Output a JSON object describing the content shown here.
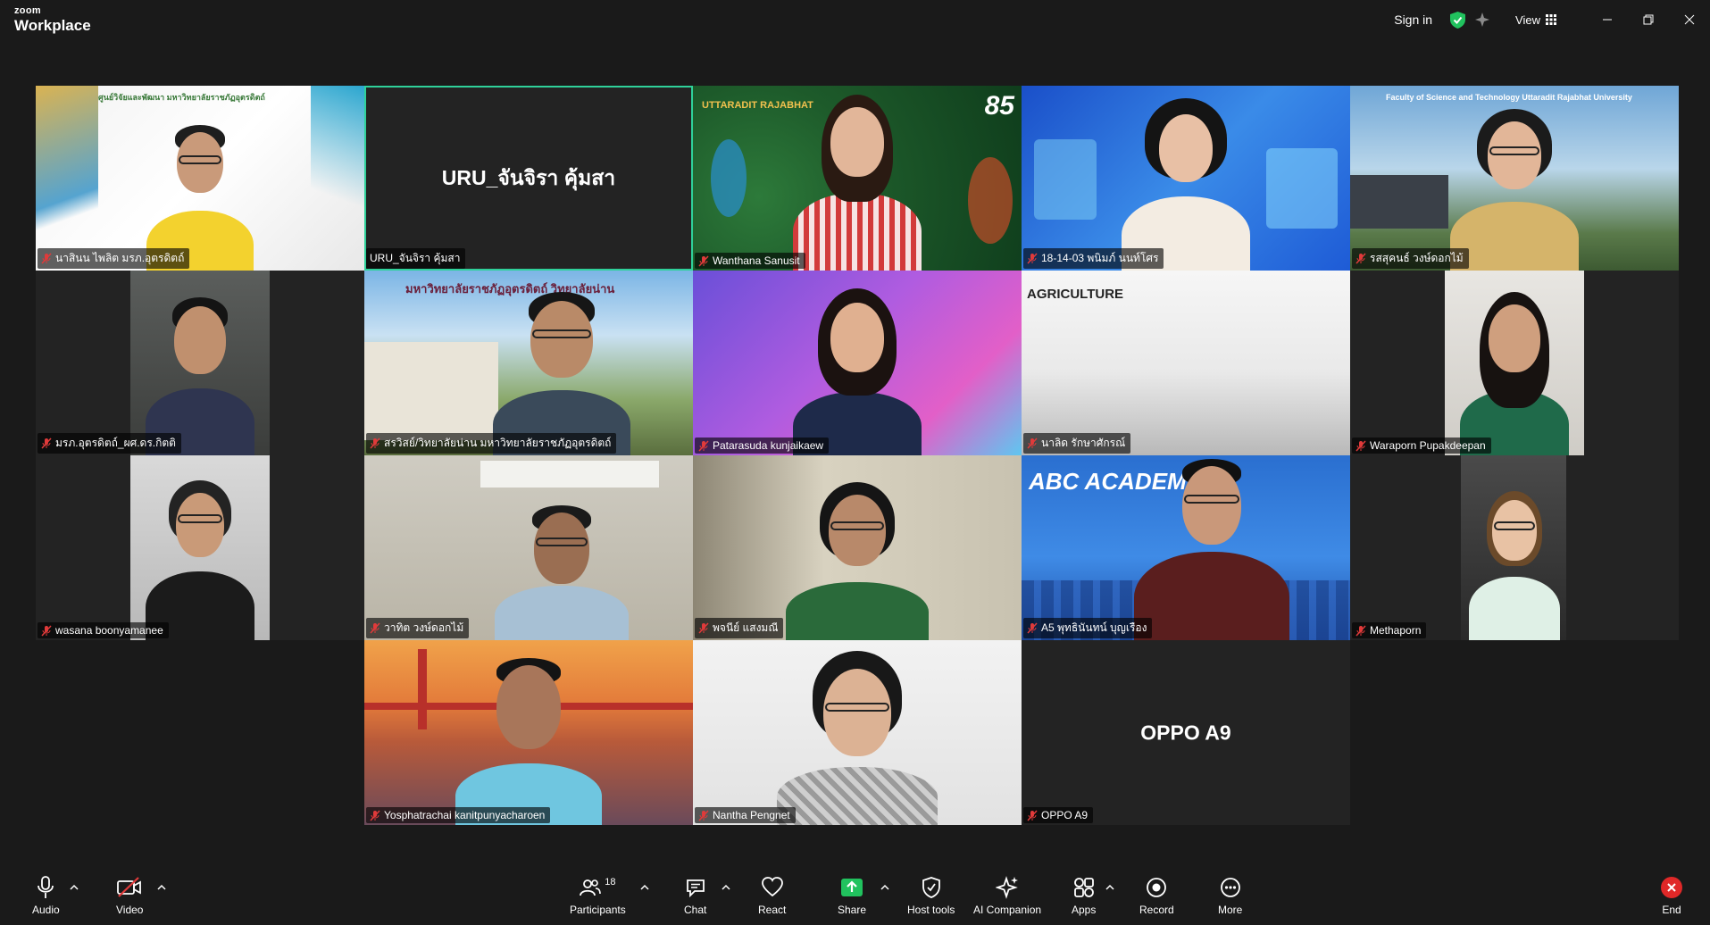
{
  "window": {
    "brand_top": "zoom",
    "brand_bottom": "Workplace",
    "sign_in": "Sign in",
    "view_label": "View",
    "icons": [
      "shield-check-icon",
      "sparkle-icon",
      "grid-icon",
      "minimize-icon",
      "restore-icon",
      "close-icon"
    ]
  },
  "tiles": [
    {
      "name": "นาสินน ไพลิต มรภ.อุตรดิตถ์",
      "muted": true,
      "bg_text": "ศูนย์วิจัยและพัฒนา มหาวิทยาลัยราชภัฏอุตรดิตถ์"
    },
    {
      "name": "URU_จันจิรา คุ้มสา",
      "muted": false,
      "display_name": "URU_จันจิรา คุ้มสา",
      "active": true
    },
    {
      "name": "Wanthana Sanusit",
      "muted": true,
      "bg_text": "UTTARADIT RAJABHAT",
      "badge": "85"
    },
    {
      "name": "18-14-03 พนิมภ์ นนท์โศร",
      "muted": true
    },
    {
      "name": "รสสุคนธ์ วงษ์ดอกไม้",
      "muted": true,
      "bg_text": "Faculty of Science and Technology Uttaradit Rajabhat University"
    },
    {
      "name": "มรภ.อุตรดิตถ์_ผศ.ดร.กิตติ",
      "muted": true
    },
    {
      "name": "สรวิสย์/วิทยาลัยน่าน มหาวิทยาลัยราชภัฏอุตรดิตถ์",
      "muted": true,
      "bg_text": "มหาวิทยาลัยราชภัฏอุตรดิตถ์ วิทยาลัยน่าน"
    },
    {
      "name": "Patarasuda kunjaikaew",
      "muted": true
    },
    {
      "name": "นาลิด รักษาศักรณ์",
      "muted": true,
      "bg_text": "AGRICULTURE"
    },
    {
      "name": "Waraporn Pupakdeepan",
      "muted": true
    },
    {
      "name": "wasana boonyamanee",
      "muted": true
    },
    {
      "name": "วาทิต วงษ์ดอกไม้",
      "muted": true
    },
    {
      "name": "พจนีย์ แสงมณี",
      "muted": true
    },
    {
      "name": "A5 พุทธินันทน์ บุญเรือง",
      "muted": true,
      "bg_text": "ABC ACADEMY"
    },
    {
      "name": "Methaporn",
      "muted": true
    },
    {
      "name": "Yosphatrachai kanitpunyacharoen",
      "muted": true
    },
    {
      "name": "Nantha Pengnet",
      "muted": true
    },
    {
      "name": "OPPO A9",
      "muted": true,
      "display_name": "OPPO A9"
    }
  ],
  "toolbar": {
    "audio": "Audio",
    "video": "Video",
    "participants": "Participants",
    "participant_count": "18",
    "chat": "Chat",
    "react": "React",
    "share": "Share",
    "host_tools": "Host tools",
    "ai_companion": "AI Companion",
    "apps": "Apps",
    "record": "Record",
    "more": "More",
    "end": "End"
  },
  "colors": {
    "background": "#1a1a1a",
    "tile": "#232323",
    "active_border": "#2fd19a",
    "share_green": "#21c25e",
    "end_red": "#e02828",
    "mute_red": "#e03a3a"
  }
}
